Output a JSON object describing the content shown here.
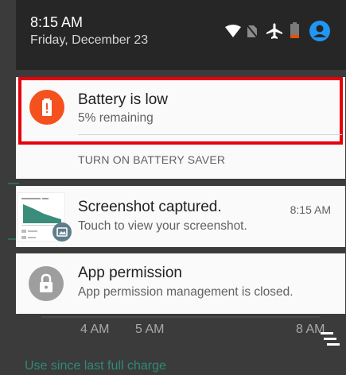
{
  "status_bar": {
    "time": "8:15 AM",
    "date": "Friday, December 23",
    "icons": [
      "wifi-icon",
      "no-sim-icon",
      "airplane-mode-icon",
      "battery-low-icon",
      "account-icon"
    ],
    "colors": {
      "accent": "#2196f3",
      "battery": "#e65100"
    }
  },
  "notifications": {
    "battery": {
      "title": "Battery is low",
      "subtitle": "5% remaining",
      "action": "TURN ON BATTERY SAVER",
      "icon": "battery-alert-icon",
      "icon_color": "#f4511e",
      "highlight_color": "#e5000c"
    },
    "screenshot": {
      "title": "Screenshot captured.",
      "subtitle": "Touch to view your screenshot.",
      "time": "8:15 AM",
      "icon": "image-icon",
      "badge_color": "#607d8b"
    },
    "permission": {
      "title": "App permission",
      "subtitle": "App permission management is closed.",
      "icon": "lock-icon",
      "icon_color": "#9e9e9e"
    }
  },
  "background_app": {
    "axis_labels": [
      "4 AM",
      "5 AM",
      "8 AM"
    ],
    "footer_label": "Use since last full charge"
  }
}
